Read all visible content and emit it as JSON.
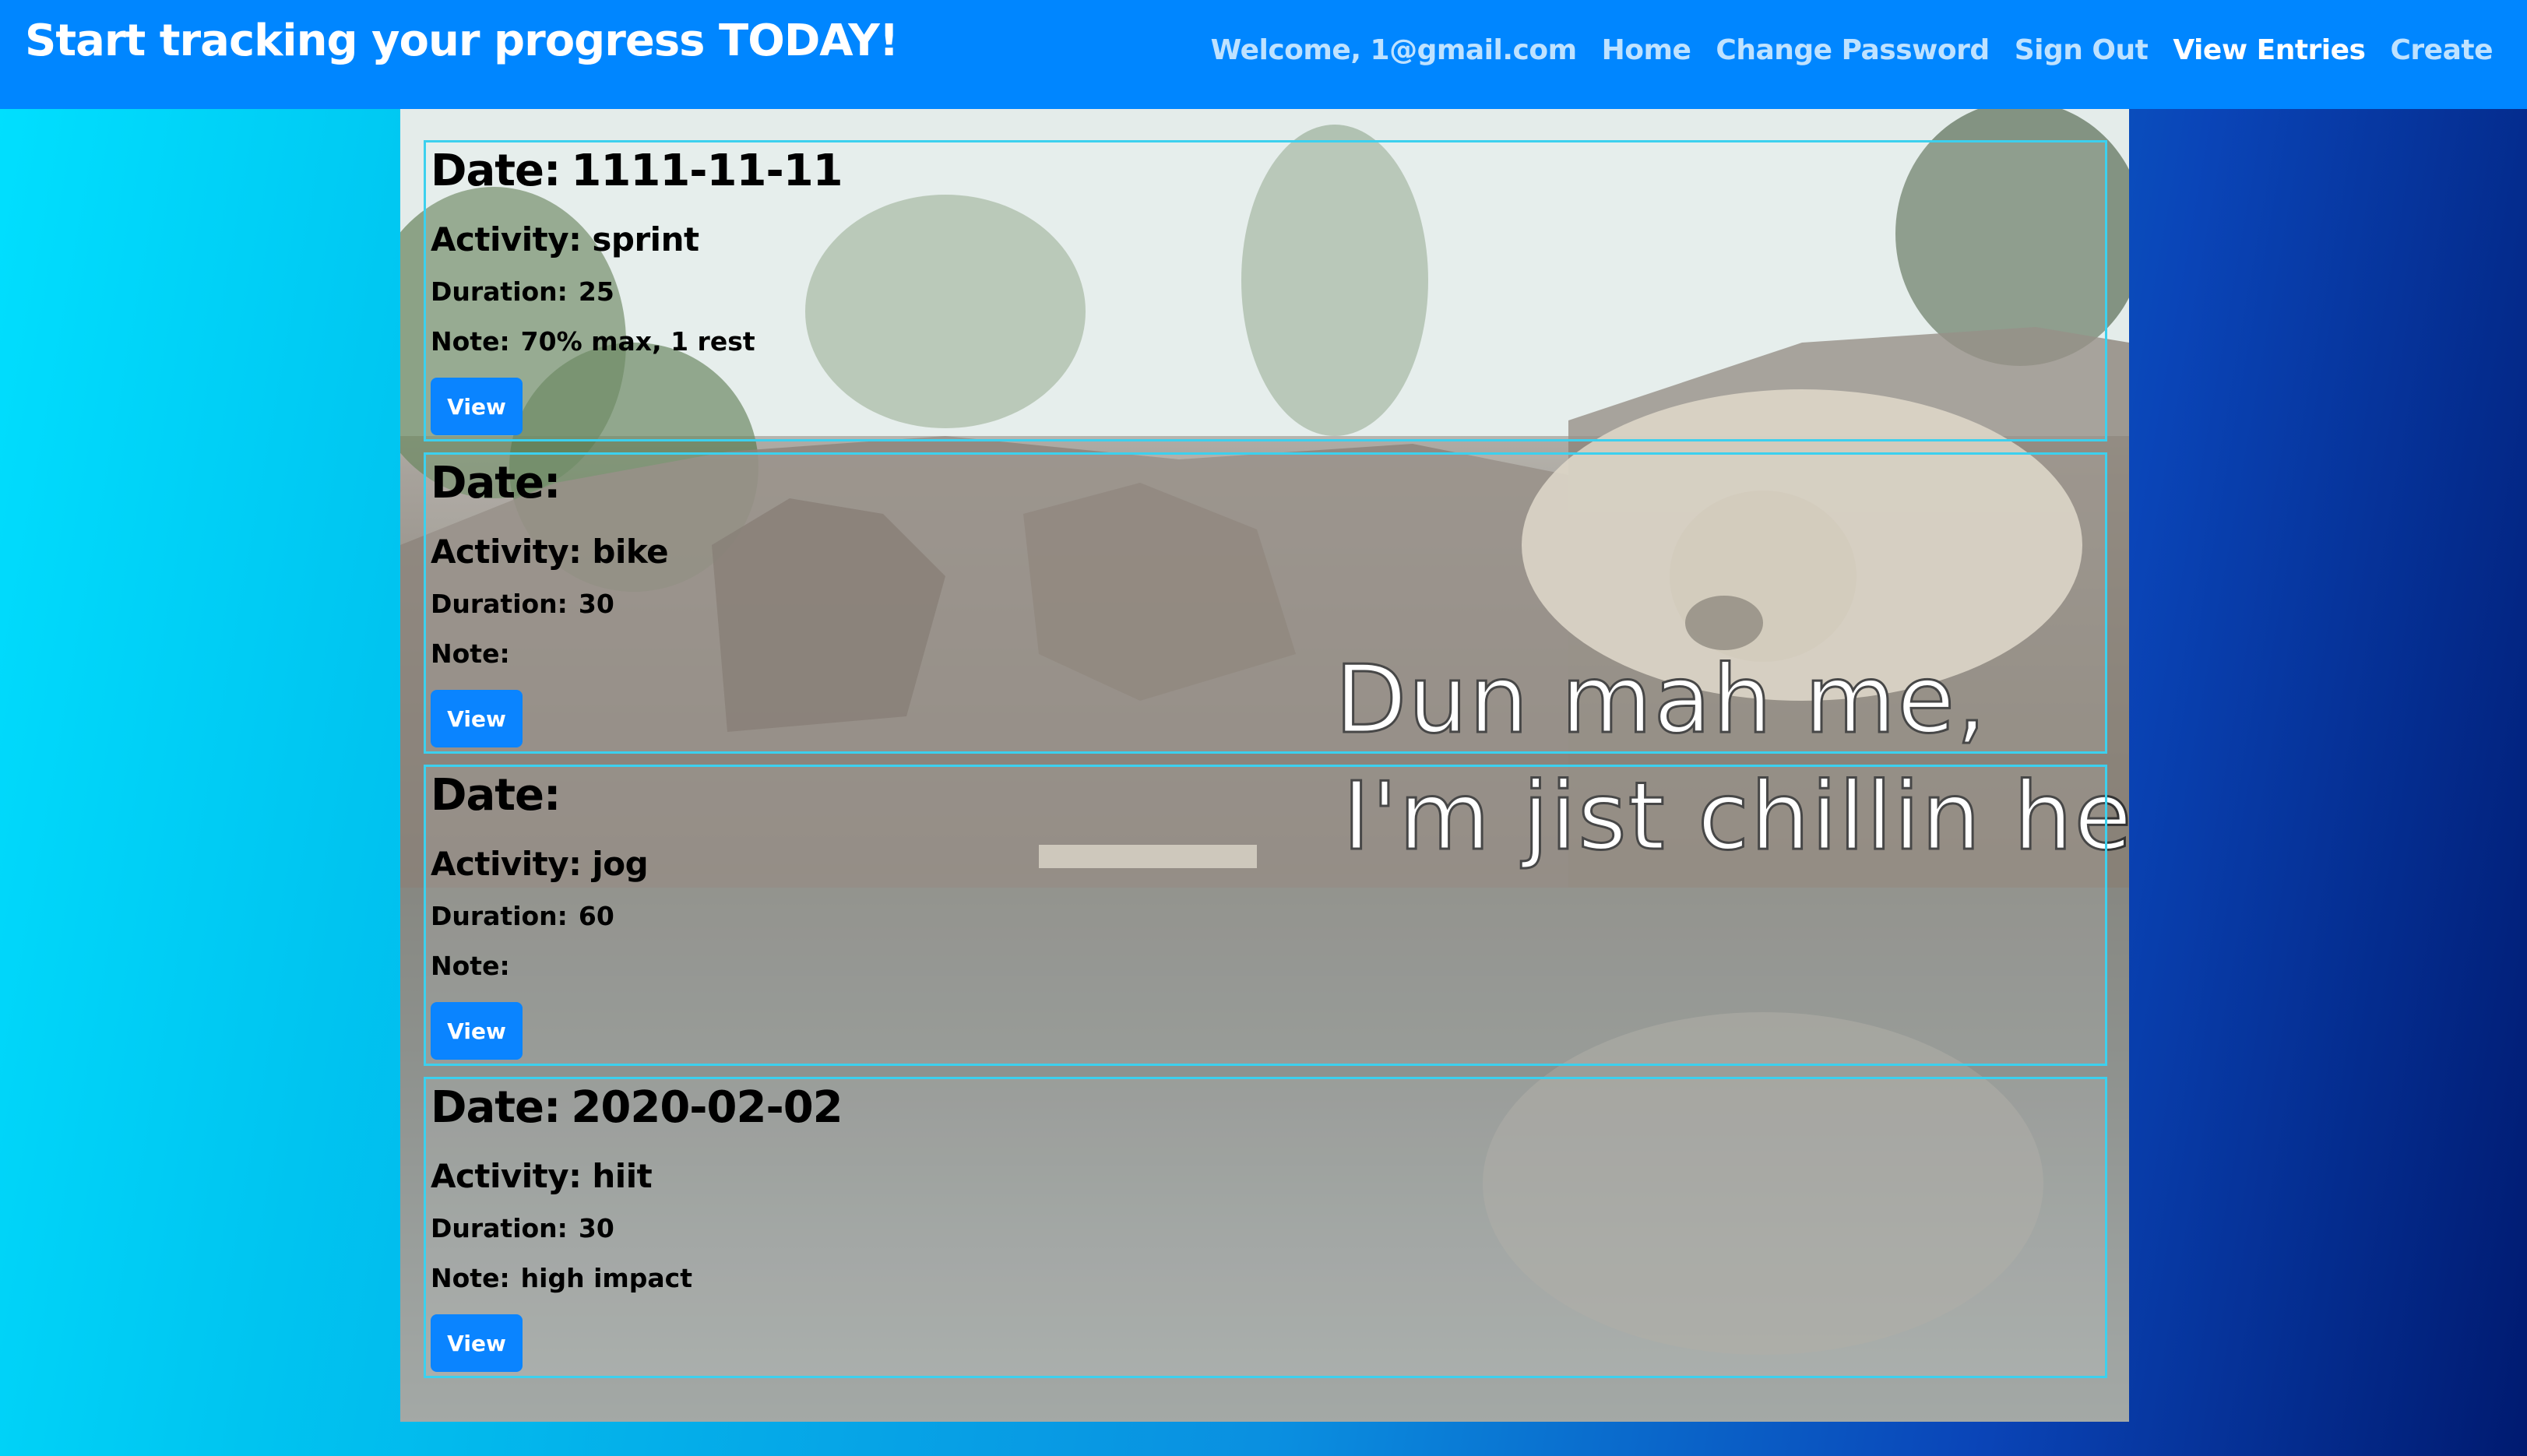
{
  "header": {
    "title": "Start tracking your progress TODAY!",
    "nav": [
      {
        "label": "Welcome, 1@gmail.com",
        "active": false
      },
      {
        "label": "Home",
        "active": false
      },
      {
        "label": "Change Password",
        "active": false
      },
      {
        "label": "Sign Out",
        "active": false
      },
      {
        "label": "View Entries",
        "active": true
      },
      {
        "label": "Create",
        "active": false
      }
    ]
  },
  "background_image": {
    "caption_line1": "Dun mah me,",
    "caption_line2": "I'm jist chillin he"
  },
  "labels": {
    "date": "Date:",
    "activity": "Activity:",
    "duration": "Duration:",
    "note": "Note:",
    "view_button": "View"
  },
  "entries": [
    {
      "date": "1111-11-11",
      "activity": "sprint",
      "duration": "25",
      "note": "70% max, 1 rest"
    },
    {
      "date": "",
      "activity": "bike",
      "duration": "30",
      "note": ""
    },
    {
      "date": "",
      "activity": "jog",
      "duration": "60",
      "note": ""
    },
    {
      "date": "2020-02-02",
      "activity": "hiit",
      "duration": "30",
      "note": "high impact"
    }
  ],
  "colors": {
    "navbar": "#0086ff",
    "button": "#0a84ff",
    "entry_border": "#3cd0ee",
    "active_link": "#ffffff",
    "inactive_link": "#bfe2ff"
  }
}
